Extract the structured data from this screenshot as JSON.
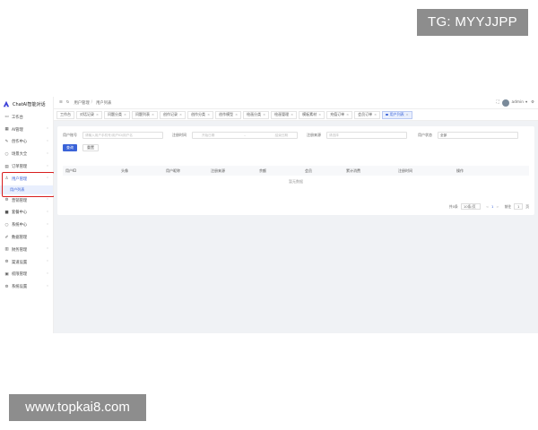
{
  "watermarks": {
    "top": "TG: MYYJJPP",
    "bottom": "www.topkai8.com"
  },
  "app": {
    "title": "ChatAI智能对话"
  },
  "sidebar": {
    "items": [
      {
        "label": "工作台",
        "icon": "monitor-icon"
      },
      {
        "label": "AI管理",
        "icon": "grid-icon"
      },
      {
        "label": "创作中心",
        "icon": "pen-icon"
      },
      {
        "label": "场景大全",
        "icon": "circle-icon"
      },
      {
        "label": "订单管理",
        "icon": "doc-icon"
      },
      {
        "label": "用户管理",
        "icon": "user-icon"
      },
      {
        "label": "用户列表",
        "icon": "",
        "sub": true
      },
      {
        "label": "营销管理",
        "icon": "gear-icon"
      },
      {
        "label": "套餐中心",
        "icon": "bag-icon"
      },
      {
        "label": "系统中心",
        "icon": "circle-icon"
      },
      {
        "label": "数据管理",
        "icon": "edit-icon"
      },
      {
        "label": "财务管理",
        "icon": "chart-icon"
      },
      {
        "label": "渠道设置",
        "icon": "settings-icon"
      },
      {
        "label": "权限管理",
        "icon": "lock-icon"
      },
      {
        "label": "系统设置",
        "icon": "gear-icon"
      }
    ]
  },
  "header": {
    "breadcrumb": [
      "用户管理",
      "用户列表"
    ],
    "user": "admin"
  },
  "tabs": [
    {
      "label": "工作台"
    },
    {
      "label": "对话记录"
    },
    {
      "label": "问题分类"
    },
    {
      "label": "问题列表"
    },
    {
      "label": "创作记录"
    },
    {
      "label": "创作分类"
    },
    {
      "label": "创作模型"
    },
    {
      "label": "绘画分类"
    },
    {
      "label": "绘画管理"
    },
    {
      "label": "模板素材"
    },
    {
      "label": "充值订单"
    },
    {
      "label": "会员订单"
    },
    {
      "label": "用户列表",
      "active": true
    }
  ],
  "filters": {
    "account_label": "用户账号",
    "account_placeholder": "请输入用户手机号/用户ID/用户名",
    "regtime_label": "注册时间",
    "start_placeholder": "开始日期",
    "date_sep": "-",
    "end_placeholder": "结束日期",
    "source_label": "注册来源",
    "source_placeholder": "请选择",
    "status_label": "用户状态",
    "status_value": "全部"
  },
  "buttons": {
    "search": "查询",
    "reset": "重置"
  },
  "table": {
    "columns": [
      "用户ID",
      "头像",
      "用户昵称",
      "注册来源",
      "余额",
      "会员",
      "累计消费",
      "注册时间",
      "操作"
    ],
    "empty": "暂无数据"
  },
  "pager": {
    "total": "共0条",
    "per_page": "10条/页",
    "prev": "<",
    "page": "1",
    "next": ">",
    "goto": "前往",
    "goto_value": "1",
    "unit": "页"
  }
}
